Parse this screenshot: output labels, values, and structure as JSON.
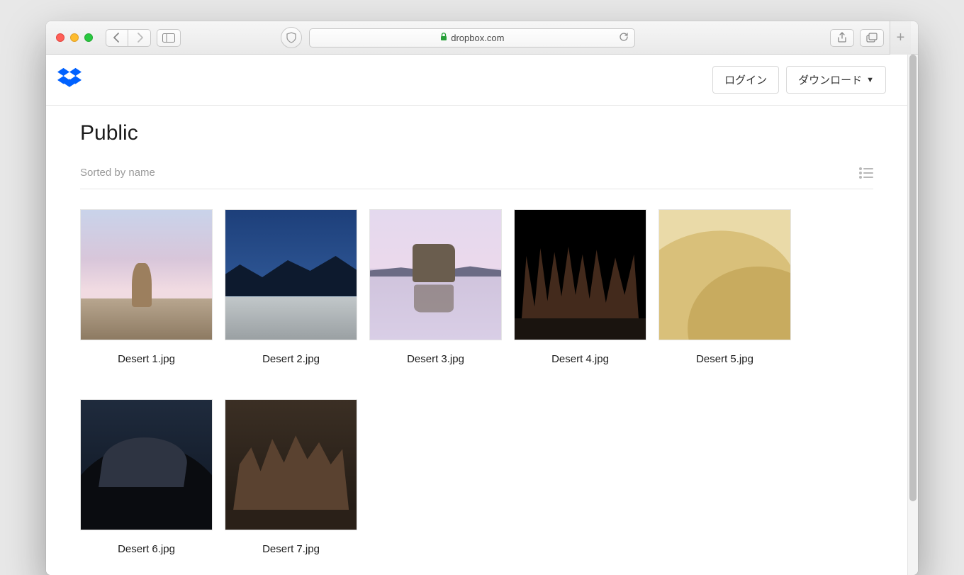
{
  "browser": {
    "host": "dropbox.com",
    "secure": true
  },
  "header": {
    "login_label": "ログイン",
    "download_label": "ダウンロード"
  },
  "folder": {
    "title": "Public",
    "sort_label": "Sorted by name"
  },
  "files": [
    {
      "name": "Desert 1.jpg"
    },
    {
      "name": "Desert 2.jpg"
    },
    {
      "name": "Desert 3.jpg"
    },
    {
      "name": "Desert 4.jpg"
    },
    {
      "name": "Desert 5.jpg"
    },
    {
      "name": "Desert 6.jpg"
    },
    {
      "name": "Desert 7.jpg"
    }
  ]
}
